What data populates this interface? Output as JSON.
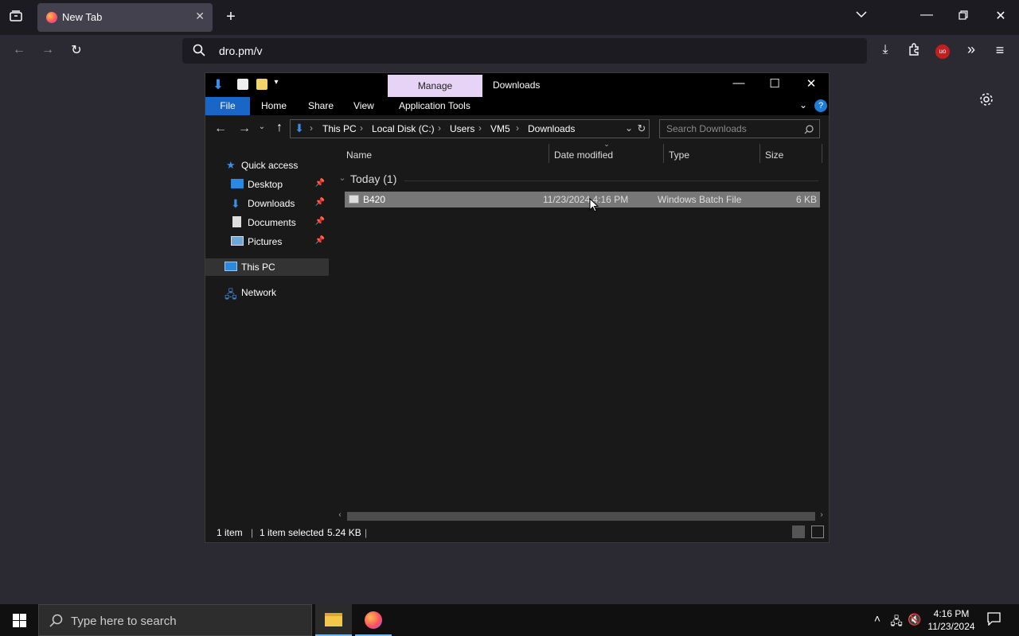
{
  "browser": {
    "tab_title": "New Tab",
    "url": "dro.pm/v"
  },
  "explorer": {
    "window_title": "Downloads",
    "context_tab": "Manage",
    "ribbon_tabs": [
      "File",
      "Home",
      "Share",
      "View",
      "Application Tools"
    ],
    "breadcrumbs": [
      "This PC",
      "Local Disk (C:)",
      "Users",
      "VM5",
      "Downloads"
    ],
    "search_placeholder": "Search Downloads",
    "nav": {
      "quick_access": "Quick access",
      "desktop": "Desktop",
      "downloads": "Downloads",
      "documents": "Documents",
      "pictures": "Pictures",
      "this_pc": "This PC",
      "network": "Network"
    },
    "columns": [
      "Name",
      "Date modified",
      "Type",
      "Size"
    ],
    "group_label": "Today (1)",
    "files": [
      {
        "name": "B420",
        "date": "11/23/2024 4:16 PM",
        "type": "Windows Batch File",
        "size": "6 KB"
      }
    ],
    "status": {
      "count": "1 item",
      "selected": "1 item selected",
      "size": "5.24 KB"
    }
  },
  "taskbar": {
    "search_placeholder": "Type here to search",
    "time": "4:16 PM",
    "date": "11/23/2024"
  },
  "colors": {
    "accent": "#1966c6",
    "manage_tab": "#e6d3f5",
    "selection": "#777777"
  }
}
